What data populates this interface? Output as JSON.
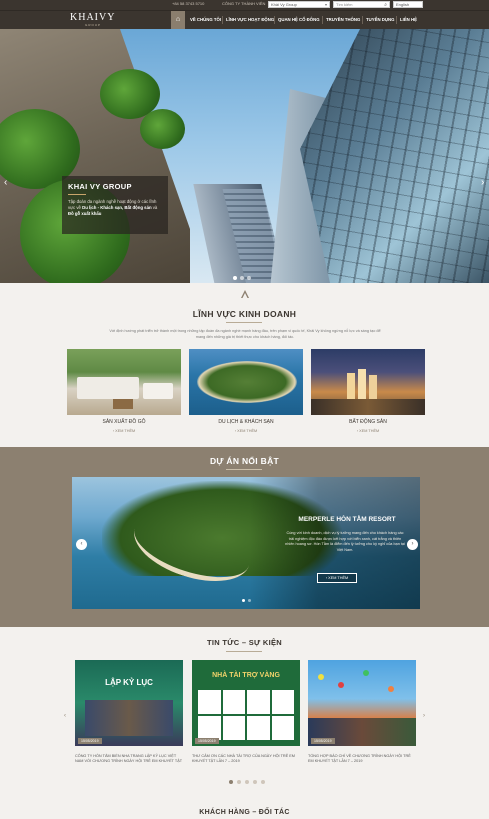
{
  "topbar": {
    "phone": "+84 58 3743 5710",
    "company_link": "CÔNG TY THÀNH VIÊN",
    "group_select": "Khải Vy Group",
    "search_placeholder": "Tìm kiếm",
    "language": "English"
  },
  "logo": {
    "text": "KHAIVY",
    "sub": "GROUP"
  },
  "nav": {
    "home_icon": "home-icon",
    "items": [
      {
        "label": "VỀ CHÚNG TÔI"
      },
      {
        "label": "LĨNH VỰC HOẠT ĐỘNG"
      },
      {
        "label": "QUAN HỆ CỔ ĐÔNG"
      },
      {
        "label": "TRUYỀN THÔNG"
      },
      {
        "label": "TUYỂN DỤNG"
      },
      {
        "label": "LIÊN HỆ"
      }
    ]
  },
  "hero": {
    "title": "KHAI VY GROUP",
    "desc_prefix": "Tập đoàn đa ngành nghề hoạt động ở các lĩnh vực về ",
    "desc_b1": "Du lịch - Khách sạn, Bất động sản",
    "desc_mid": " và ",
    "desc_b2": "Đồ gỗ xuất khẩu",
    "arrow_left": "‹",
    "arrow_right": "›"
  },
  "business": {
    "title": "LĨNH VỰC KINH DOANH",
    "intro": "Với định hướng phát triển trở thành một trong những tập đoàn đa ngành nghề mạnh hàng đầu, trên phạm vi quốc tế, Khải Vy không ngừng nỗ lực và sáng tạo để mang đến những giá trị thiết thực cho khách hàng, đối tác.",
    "items": [
      {
        "label": "SẢN XUẤT ĐỒ GỖ",
        "more": "› XEM THÊM"
      },
      {
        "label": "DU LỊCH & KHÁCH SẠN",
        "more": "› XEM THÊM"
      },
      {
        "label": "BẤT ĐỘNG SẢN",
        "more": "› XEM THÊM"
      }
    ]
  },
  "projects": {
    "title": "DỰ ÁN NỔI BẬT",
    "slide_title": "MERPERLE HÒN TẰM RESORT",
    "slide_desc": "Cùng với kinh doanh, dịch vụ lý tưởng mang đến cho khách hàng các trải nghiệm độc đáo được kết hợp với biển xanh, cát trắng và thiên nhiên hoang sơ. Hòn Tằm là điểm đến lý tưởng cho kỳ nghỉ của bạn tại Việt Nam.",
    "button": "› XEM THÊM",
    "arrow_left": "‹",
    "arrow_right": "›"
  },
  "news": {
    "title": "TIN TỨC – SỰ KIỆN",
    "items": [
      {
        "img_text": "LẬP KỶ LỤC",
        "date": "15/05/2019",
        "text": "Công ty Hòn Tằm biển Nha Trang lập kỷ lục Việt Nam với chương trình ngày hội trẻ em khuyết tật"
      },
      {
        "img_text": "NHÀ TÀI TRỢ VÀNG",
        "date": "15/05/2019",
        "text": "Thư cảm ơn các nhà tài trợ của ngày hội trẻ em khuyết tật lần 7 – 2019"
      },
      {
        "img_text": "",
        "date": "15/05/2019",
        "text": "Tổng hợp báo chí về chương trình ngày hội trẻ em khuyết tật lần 7 – 2019"
      }
    ],
    "arrow_left": "‹",
    "arrow_right": "›"
  },
  "partners": {
    "title": "KHÁCH HÀNG – ĐỐI TÁC"
  },
  "colors": {
    "brand_dark": "#3b352f",
    "brand_taupe": "#8c8070",
    "accent_gold": "#c9a66b"
  }
}
